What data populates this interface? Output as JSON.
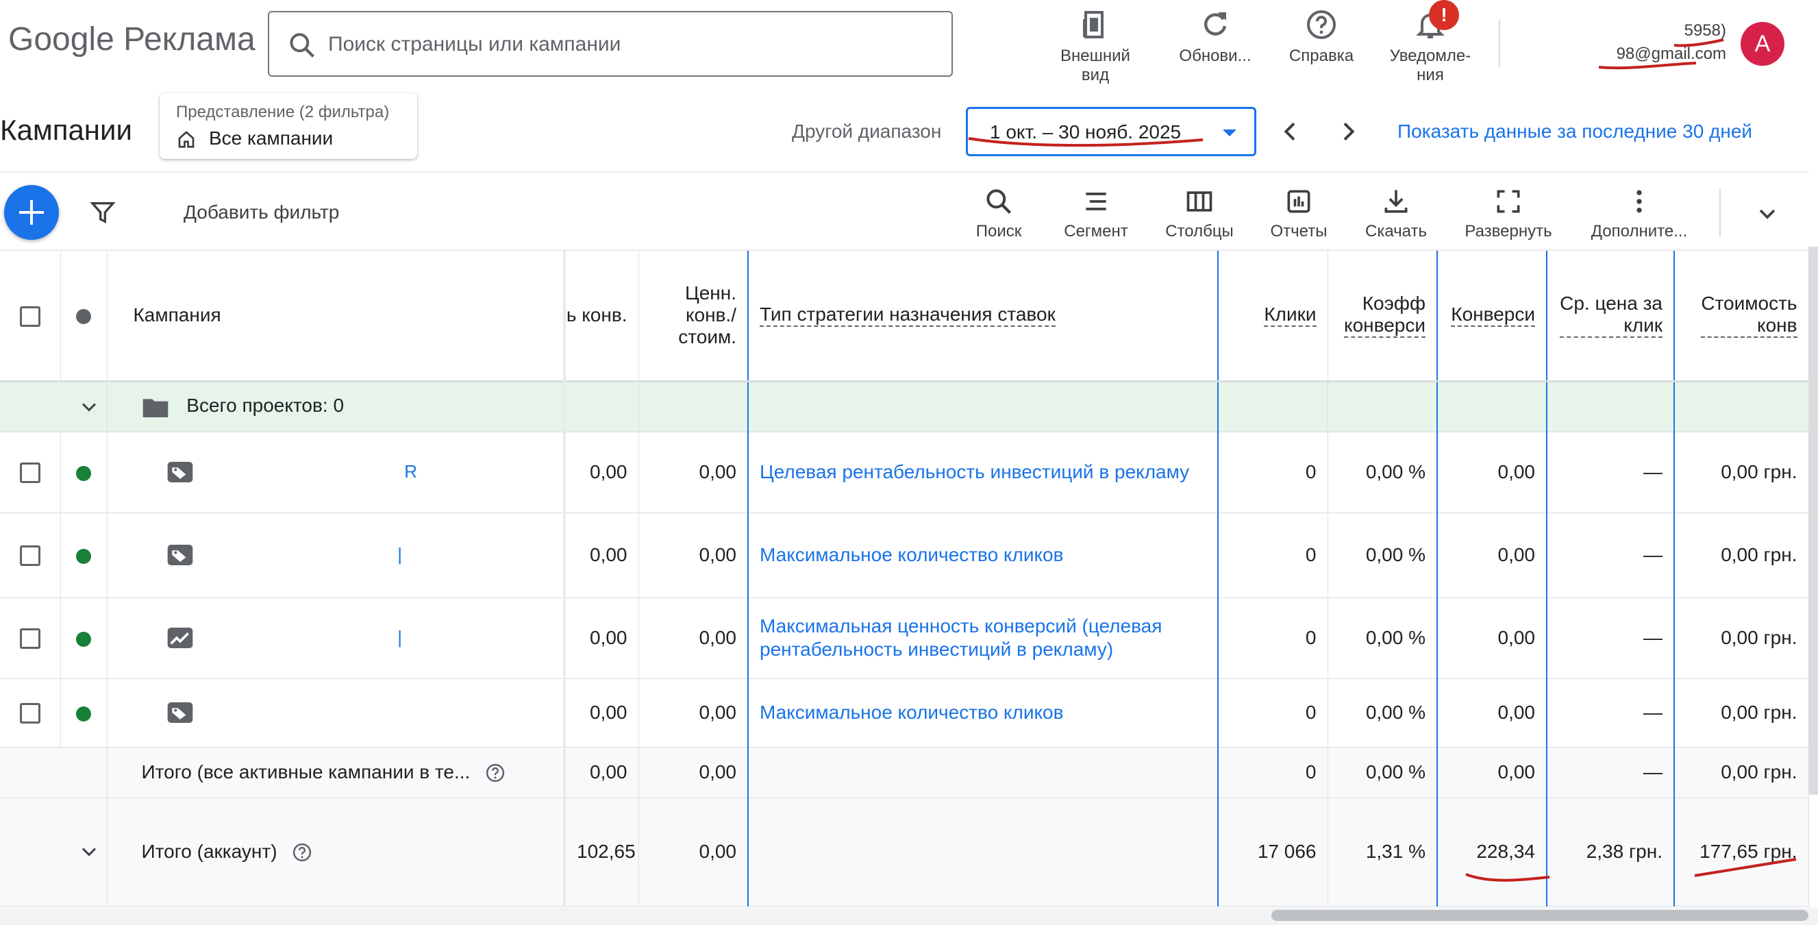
{
  "brand": {
    "google": "Google",
    "product": "Реклама"
  },
  "search": {
    "placeholder": "Поиск страницы или кампании"
  },
  "tools": {
    "appearance": [
      "Внешний",
      "вид"
    ],
    "refresh": "Обнови...",
    "help": "Справка",
    "notifications": [
      "Уведомле-",
      "ния"
    ],
    "notifications_badge": "!"
  },
  "account": {
    "id_suffix": "5958)",
    "email_suffix": "98@gmail.com",
    "avatar_letter": "A"
  },
  "header": {
    "title": "Кампании",
    "view_label": "Представление (2 фильтра)",
    "view_value": "Все кампании",
    "range_label": "Другой диапазон",
    "range_value": "1 окт. – 30 нояб. 2025",
    "last30": "Показать данные за последние 30 дней"
  },
  "toolbar": {
    "add_filter": "Добавить фильтр",
    "items": [
      "Поиск",
      "Сегмент",
      "Столбцы",
      "Отчеты",
      "Скачать",
      "Развернуть",
      "Дополните..."
    ]
  },
  "table": {
    "headers": {
      "campaign": "Кампания",
      "conv_value": "ь конв.",
      "value_cost": [
        "Ценн.",
        "конв./",
        "стоим."
      ],
      "strategy": "Тип стратегии назначения ставок",
      "clicks": "Клики",
      "conv_rate": [
        "Коэфф",
        "конверси"
      ],
      "conversions": "Конверси",
      "avg_cpc": [
        "Ср. цена за",
        "клик"
      ],
      "cost_conv": [
        "Стоимость",
        "конв"
      ]
    },
    "group_row": {
      "label": "Всего проектов: 0"
    },
    "rows": [
      {
        "name": "R",
        "conv_value": "0,00",
        "value_cost": "0,00",
        "strategy": "Целевая рентабельность инвестиций в рекламу",
        "clicks": "0",
        "conv_rate": "0,00 %",
        "conversions": "0,00",
        "avg_cpc": "—",
        "cost_conv": "0,00 грн."
      },
      {
        "name": "|",
        "conv_value": "0,00",
        "value_cost": "0,00",
        "strategy": "Максимальное количество кликов",
        "clicks": "0",
        "conv_rate": "0,00 %",
        "conversions": "0,00",
        "avg_cpc": "—",
        "cost_conv": "0,00 грн."
      },
      {
        "name": "|",
        "conv_value": "0,00",
        "value_cost": "0,00",
        "strategy": "Максимальная ценность конверсий (целевая рентабельность инвестиций в рекламу)",
        "clicks": "0",
        "conv_rate": "0,00 %",
        "conversions": "0,00",
        "avg_cpc": "—",
        "cost_conv": "0,00 грн."
      },
      {
        "name": "",
        "conv_value": "0,00",
        "value_cost": "0,00",
        "strategy": "Максимальное количество кликов",
        "clicks": "0",
        "conv_rate": "0,00 %",
        "conversions": "0,00",
        "avg_cpc": "—",
        "cost_conv": "0,00 грн."
      }
    ],
    "total_active": {
      "label": "Итого (все активные кампании в те...",
      "conv_value": "0,00",
      "value_cost": "0,00",
      "clicks": "0",
      "conv_rate": "0,00 %",
      "conversions": "0,00",
      "avg_cpc": "—",
      "cost_conv": "0,00 грн."
    },
    "total_account": {
      "label": "Итого (аккаунт)",
      "conv_value": "102,65",
      "value_cost": "0,00",
      "clicks": "17 066",
      "conv_rate": "1,31 %",
      "conversions": "228,34",
      "avg_cpc": "2,38 грн.",
      "cost_conv": "177,65 грн."
    }
  },
  "colors": {
    "accent": "#1a73e8",
    "status_enabled": "#188038",
    "group_bg": "#e6f4ea",
    "avatar": "#d6224a",
    "annotation": "#c5221f"
  }
}
